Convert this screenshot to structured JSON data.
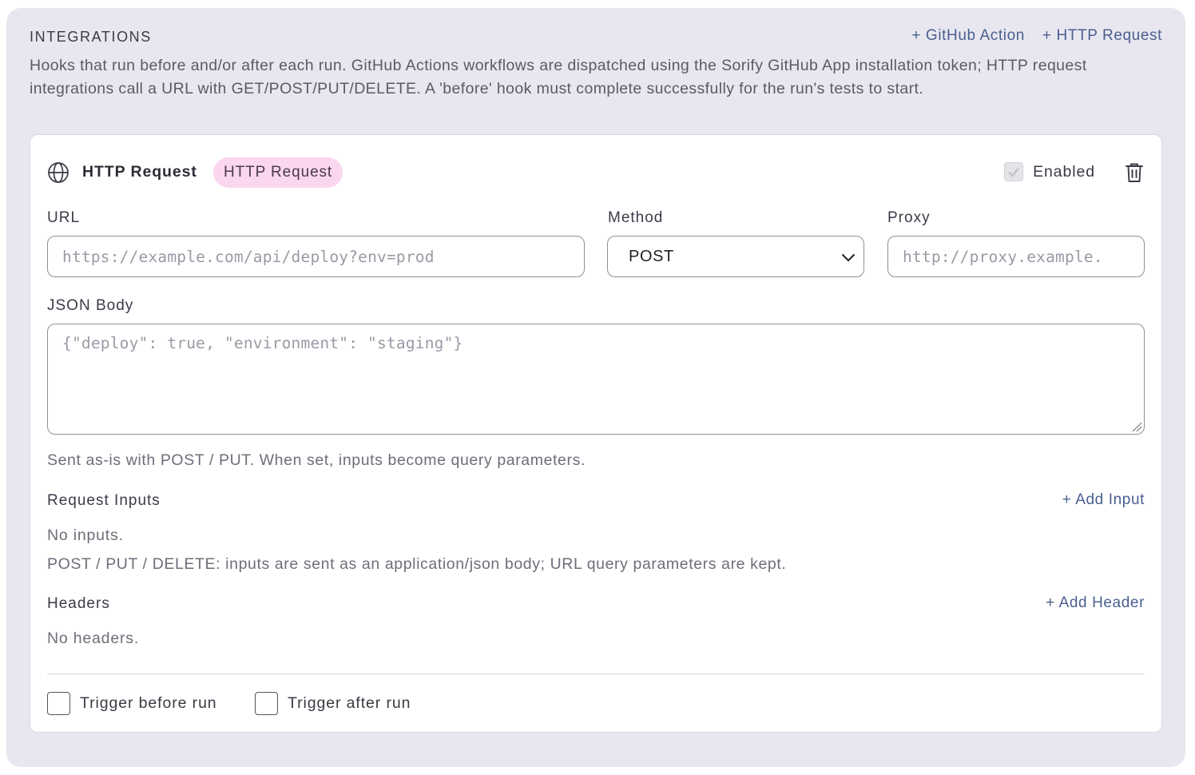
{
  "section": {
    "title": "INTEGRATIONS",
    "add_github_action": "+ GitHub Action",
    "add_http_request": "+ HTTP Request",
    "description": "Hooks that run before and/or after each run. GitHub Actions workflows are dispatched using the Sorify GitHub App installation token; HTTP request integrations call a URL with GET/POST/PUT/DELETE. A 'before' hook must complete successfully for the run's tests to start."
  },
  "card": {
    "title": "HTTP Request",
    "badge": "HTTP Request",
    "badge_color": "#fad6ef",
    "enabled_label": "Enabled",
    "enabled_checked": true,
    "icon": "globe-icon",
    "delete_icon": "trash-icon"
  },
  "fields": {
    "url_label": "URL",
    "url_value": "",
    "url_placeholder": "https://example.com/api/deploy?env=prod",
    "method_label": "Method",
    "method_value": "POST",
    "proxy_label": "Proxy",
    "proxy_value": "",
    "proxy_placeholder": "http://proxy.example.",
    "body_label": "JSON Body",
    "body_value": "",
    "body_placeholder": "{\"deploy\": true, \"environment\": \"staging\"}",
    "body_help": "Sent as-is with POST / PUT. When set, inputs become query parameters."
  },
  "request_inputs": {
    "title": "Request Inputs",
    "add_label": "+ Add Input",
    "empty_text": "No inputs.",
    "help": "POST / PUT / DELETE: inputs are sent as an application/json body; URL query parameters are kept."
  },
  "headers": {
    "title": "Headers",
    "add_label": "+ Add Header",
    "empty_text": "No headers."
  },
  "triggers": {
    "before_label": "Trigger before run",
    "before_checked": false,
    "after_label": "Trigger after run",
    "after_checked": false
  },
  "colors": {
    "panel_bg": "#e8e7f0",
    "link": "#4a5f8f"
  }
}
